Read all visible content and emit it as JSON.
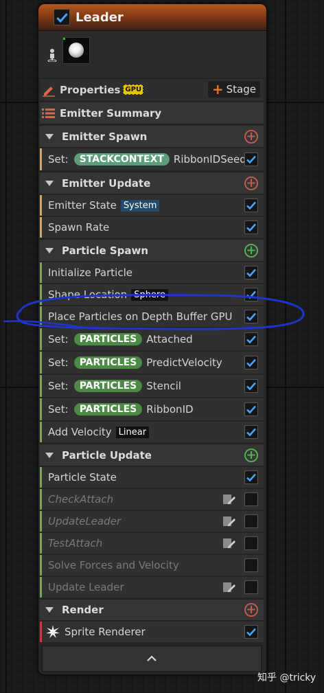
{
  "node": {
    "title": "Leader",
    "enabled": true
  },
  "thumbnail": {
    "person_icon": "person-pin-icon",
    "preview": "particle-preview"
  },
  "properties": {
    "label": "Properties",
    "gpu_badge": "GPU",
    "stage_label": "Stage"
  },
  "summary": {
    "label": "Emitter Summary"
  },
  "sections": {
    "emitter_spawn": {
      "label": "Emitter Spawn"
    },
    "emitter_update": {
      "label": "Emitter Update"
    },
    "particle_spawn": {
      "label": "Particle Spawn"
    },
    "particle_update": {
      "label": "Particle Update"
    },
    "render": {
      "label": "Render"
    }
  },
  "items": {
    "ribbon_seed": {
      "prefix": "Set:",
      "pill": "STACKCONTEXT",
      "label": "RibbonIDSeed"
    },
    "emitter_state": {
      "label": "Emitter State",
      "tag": "System"
    },
    "spawn_rate": {
      "label": "Spawn Rate"
    },
    "initialize_particle": {
      "label": "Initialize Particle"
    },
    "shape_location": {
      "label": "Shape Location",
      "tag": "Sphere"
    },
    "place_particles": {
      "label": "Place Particles on Depth Buffer GPU"
    },
    "set_attached": {
      "prefix": "Set:",
      "pill": "PARTICLES",
      "label": "Attached"
    },
    "set_predict": {
      "prefix": "Set:",
      "pill": "PARTICLES",
      "label": "PredictVelocity"
    },
    "set_stencil": {
      "prefix": "Set:",
      "pill": "PARTICLES",
      "label": "Stencil"
    },
    "set_ribbon": {
      "prefix": "Set:",
      "pill": "PARTICLES",
      "label": "RibbonID"
    },
    "add_velocity": {
      "label": "Add Velocity",
      "tag": "Linear"
    },
    "particle_state": {
      "label": "Particle State"
    },
    "check_attach": {
      "label": "CheckAttach"
    },
    "update_leader_i": {
      "label": "UpdateLeader"
    },
    "test_attach": {
      "label": "TestAttach"
    },
    "solve_forces": {
      "label": "Solve Forces and Velocity"
    },
    "update_leader": {
      "label": "Update Leader"
    },
    "sprite_renderer": {
      "label": "Sprite Renderer"
    }
  },
  "watermark": "知乎 @tricky",
  "colors": {
    "check": "#4aa3ff",
    "emitter_bar": "#c9a86a",
    "particle_bar": "#7fa35a",
    "render_bar": "#b34646",
    "annotation": "#1f35c8"
  }
}
